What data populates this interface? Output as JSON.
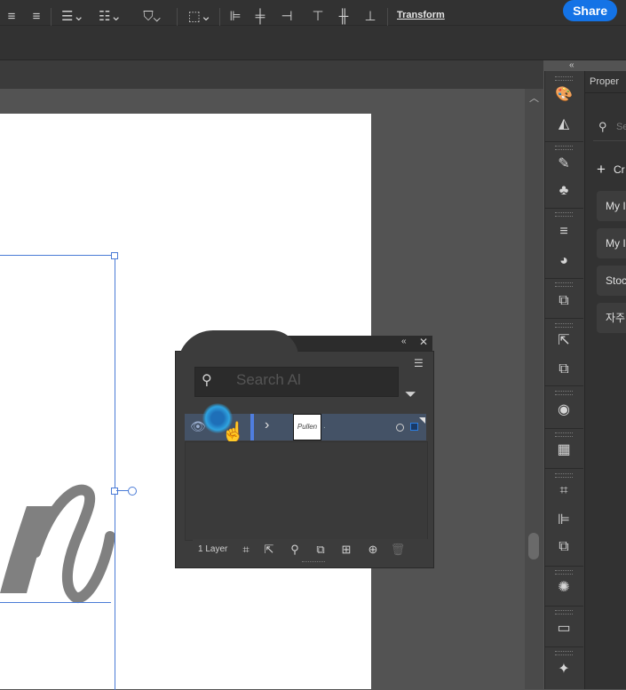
{
  "header": {
    "share_label": "Share"
  },
  "control_bar": {
    "transform_label": "Transform",
    "icons": [
      "align-left-icon",
      "align-right-icon",
      "bullet-list-icon",
      "numbered-list-icon",
      "glyph-icon",
      "shape-icon",
      "align-left-edge-icon",
      "align-h-center-icon",
      "align-right-edge-icon",
      "align-top-icon",
      "align-v-center-icon",
      "align-bottom-icon"
    ]
  },
  "canvas": {
    "artwork_text": "n",
    "artboard_color": "#ffffff",
    "selection_color": "#4a7bd6"
  },
  "layers_panel": {
    "search_placeholder": "Search Al",
    "row_thumb_text": "Pullen",
    "row_dot": ".",
    "layer_count": "1 Layer",
    "row_highlight": "#445266",
    "accent": "#1473e6"
  },
  "properties_panel": {
    "tab_label": "Proper",
    "search_placeholder": "Se",
    "create_label": "Cr",
    "items": [
      "My I",
      "My I",
      "Stoc",
      "자주"
    ]
  },
  "tool_column": {
    "icons": [
      "color-palette-icon",
      "gradient-icon",
      "brushes-icon",
      "symbols-icon",
      "stroke-icon",
      "transparency-icon",
      "export-icon",
      "asset-export-icon",
      "artboards-icon",
      "appearance-icon",
      "swatches-icon",
      "transform-icon",
      "align-icon",
      "pathfinder-icon",
      "graphic-styles-icon",
      "gradient-fill-icon",
      "magic-wand-icon"
    ]
  }
}
